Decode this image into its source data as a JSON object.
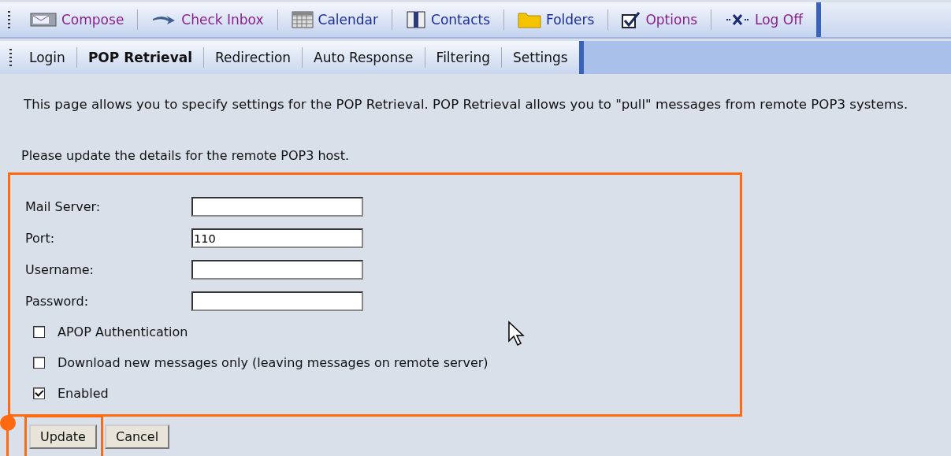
{
  "main_toolbar": [
    {
      "label": "Compose",
      "kind": "compose",
      "color": "#8a1f8f"
    },
    {
      "label": "Check Inbox",
      "kind": "arrow",
      "color": "#8a1f8f"
    },
    {
      "label": "Calendar",
      "kind": "calendar",
      "color": "#1c2c9c"
    },
    {
      "label": "Contacts",
      "kind": "book",
      "color": "#1c2c9c"
    },
    {
      "label": "Folders",
      "kind": "folder",
      "color": "#1c2c9c"
    },
    {
      "label": "Options",
      "kind": "check",
      "color": "#8a1f8f"
    },
    {
      "label": "Log Off",
      "kind": "logoff",
      "color": "#8a1f8f"
    }
  ],
  "sub_tabs": [
    {
      "label": "Login",
      "selected": false
    },
    {
      "label": "POP Retrieval",
      "selected": true
    },
    {
      "label": "Redirection",
      "selected": false
    },
    {
      "label": "Auto Response",
      "selected": false
    },
    {
      "label": "Filtering",
      "selected": false
    },
    {
      "label": "Settings",
      "selected": false
    }
  ],
  "intro": "This page allows you to specify settings for the POP Retrieval. POP Retrieval allows you to \"pull\" messages from remote POP3 systems.",
  "instruction": "Please update the details for the remote POP3 host.",
  "fields": [
    {
      "label": "Mail Server:"
    },
    {
      "label": "Port:",
      "value": "110"
    },
    {
      "label": "Username:"
    },
    {
      "label": "Password:"
    }
  ],
  "options": [
    {
      "label": "APOP Authentication",
      "checked": false
    },
    {
      "label": "Download new messages only (leaving messages on remote server)",
      "checked": false
    },
    {
      "label": "Enabled",
      "checked": true
    }
  ],
  "buttons": [
    "Update",
    "Cancel"
  ]
}
